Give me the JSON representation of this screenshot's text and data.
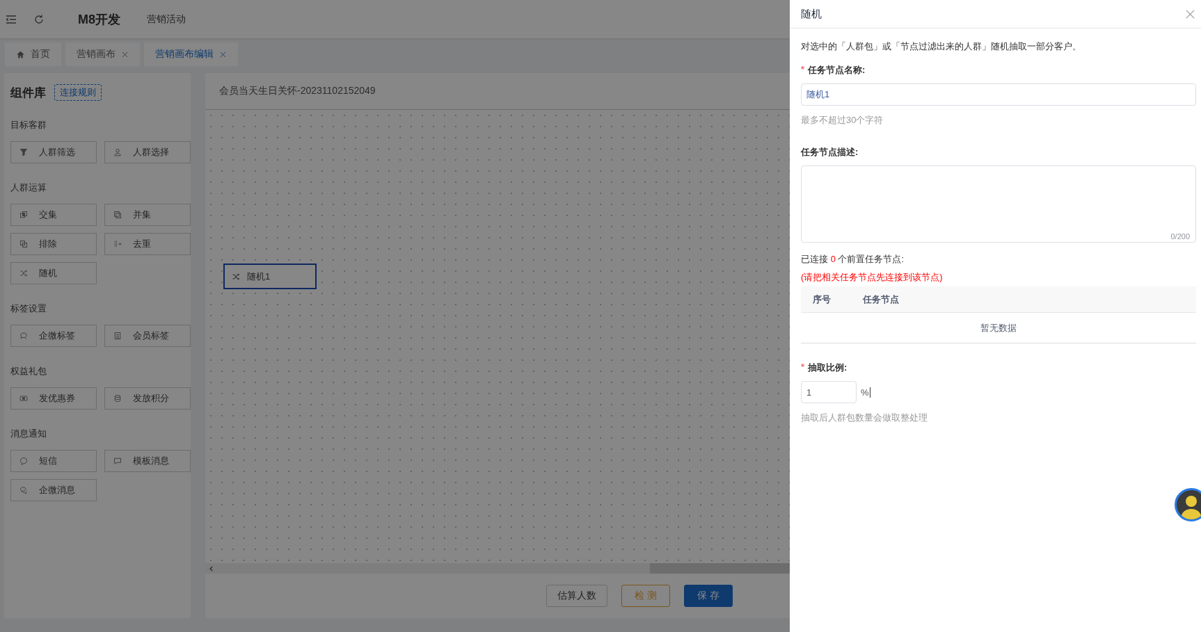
{
  "header": {
    "app_title": "M8开发",
    "breadcrumb": "营销活动"
  },
  "tabs": [
    {
      "label": "首页",
      "selected": false,
      "closable": false
    },
    {
      "label": "营销画布",
      "selected": false,
      "closable": true
    },
    {
      "label": "营销画布编辑",
      "selected": true,
      "closable": true
    }
  ],
  "component_library": {
    "title": "组件库",
    "rules_link": "连接规则",
    "groups": [
      {
        "title": "目标客群",
        "items": [
          "人群筛选",
          "人群选择"
        ]
      },
      {
        "title": "人群运算",
        "items": [
          "交集",
          "并集",
          "排除",
          "去重",
          "随机"
        ]
      },
      {
        "title": "标签设置",
        "items": [
          "企微标签",
          "会员标签"
        ]
      },
      {
        "title": "权益礼包",
        "items": [
          "发优惠券",
          "发放积分"
        ]
      },
      {
        "title": "消息通知",
        "items": [
          "短信",
          "模板消息",
          "企微消息"
        ]
      }
    ]
  },
  "canvas": {
    "title": "会员当天生日关怀-20231102152049",
    "nodes": [
      {
        "label": "随机1",
        "selected": true
      }
    ],
    "buttons": [
      {
        "label": "估算人数",
        "kind": "default"
      },
      {
        "label": "检 测",
        "kind": "warning"
      },
      {
        "label": "保 存",
        "kind": "primary"
      }
    ]
  },
  "drawer": {
    "title": "随机",
    "description": "对选中的「人群包」或「节点过滤出来的人群」随机抽取一部分客户。",
    "name_field": {
      "label": "任务节点名称:",
      "required_mark": "*",
      "value": "随机1",
      "hint": "最多不超过30个字符"
    },
    "desc_field": {
      "label": "任务节点描述:",
      "counter": "0/200"
    },
    "connected": {
      "prefix": "已连接",
      "count": "0",
      "suffix": "个前置任务节点:"
    },
    "warning": "(请把相关任务节点先连接到该节点)",
    "table": {
      "columns": [
        "序号",
        "任务节点"
      ],
      "empty_text": "暂无数据"
    },
    "ratio_field": {
      "label": "抽取比例:",
      "required_mark": "*",
      "value": "1",
      "unit": "%",
      "hint": "抽取后人群包数量会做取整处理"
    }
  }
}
